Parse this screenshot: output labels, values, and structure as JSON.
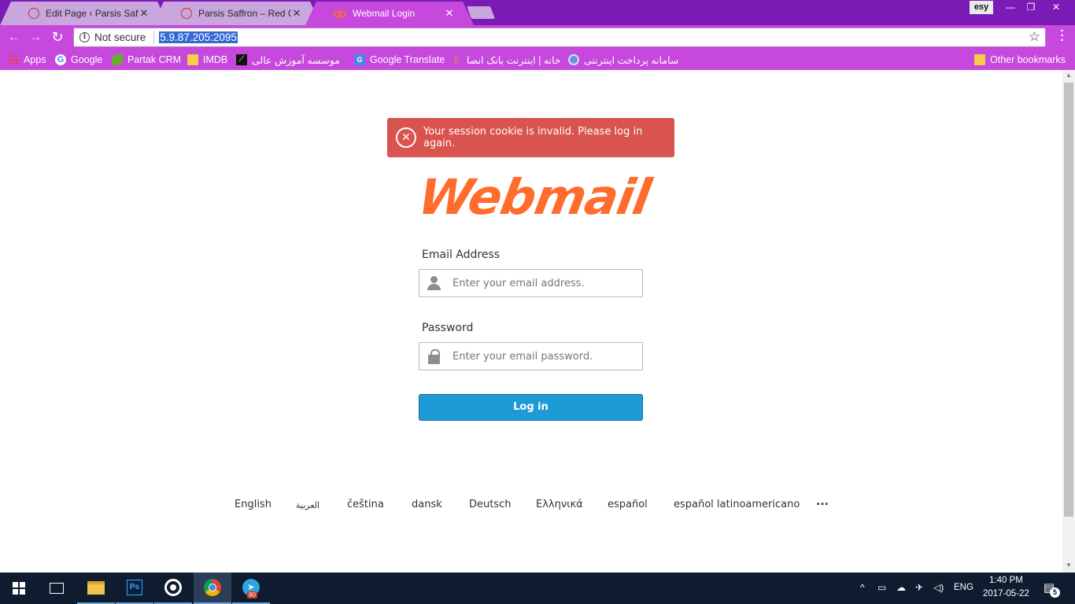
{
  "browser": {
    "tabs": [
      {
        "title": "Edit Page ‹ Parsis Saffron",
        "close": "✕",
        "active": false
      },
      {
        "title": "Parsis Saffron – Red Gold",
        "close": "✕",
        "active": false
      },
      {
        "title": "Webmail Login",
        "close": "✕",
        "active": true
      }
    ],
    "profile_label": "esy",
    "window_controls": {
      "minimize": "—",
      "maximize": "❐",
      "close": "✕"
    },
    "nav": {
      "back": "←",
      "forward": "→",
      "reload": "↻"
    },
    "security_icon": "i",
    "security_text": "Not secure",
    "url": "5.9.87.205:2095",
    "star": "☆",
    "menu": "⋮"
  },
  "bookmarks": {
    "apps": "Apps",
    "google": "Google",
    "partak": "Partak CRM",
    "imdb": "IMDB",
    "moassese": "موسسه آموزش عالی",
    "translate": "Google Translate",
    "bank": "خانه | اینترنت بانک انصا",
    "pay": "سامانه پرداخت اینترنتی",
    "other": "Other bookmarks"
  },
  "login": {
    "error_message": "Your session cookie is invalid. Please log in again.",
    "logo_text": "Webmail",
    "email_label": "Email Address",
    "email_placeholder": "Enter your email address.",
    "email_value": "",
    "password_label": "Password",
    "password_placeholder": "Enter your email password.",
    "password_value": "",
    "login_button": "Log in"
  },
  "languages": [
    "English",
    "العربية",
    "čeština",
    "dansk",
    "Deutsch",
    "Ελληνικά",
    "español",
    "español latinoamericano",
    "..."
  ],
  "taskbar": {
    "tray_chevron": "^",
    "tray_lang": "ENG",
    "clock_time": "1:40 PM",
    "clock_date": "2017-05-22",
    "telegram_badge": "80",
    "notification_count": "5"
  },
  "colors": {
    "browser_frame": "#7a1bb5",
    "browser_toolbar": "#c648dc",
    "error_bg": "#d9534f",
    "logo": "#ff6c2c",
    "login_button": "#1e9ad6",
    "taskbar": "#0f1b2e"
  }
}
